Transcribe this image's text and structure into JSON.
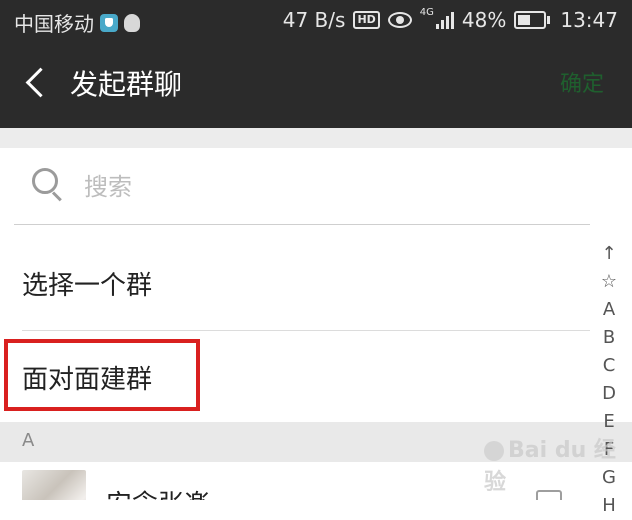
{
  "status_bar": {
    "carrier": "中国移动",
    "speed": "47 B/s",
    "hd": "HD",
    "network": "4G",
    "battery": "48%",
    "time": "13:47"
  },
  "title_bar": {
    "title": "发起群聊",
    "confirm_label": "确定"
  },
  "search": {
    "placeholder": "搜索",
    "value": ""
  },
  "options": {
    "select_group": "选择一个群",
    "face_to_face": "面对面建群"
  },
  "section": {
    "header": "A"
  },
  "contacts": [
    {
      "name": "安念张楽",
      "checked": false
    }
  ],
  "index_bar": [
    "↑",
    "☆",
    "A",
    "B",
    "C",
    "D",
    "E",
    "F",
    "G",
    "H"
  ],
  "watermark": {
    "text": "Bai du 经验"
  },
  "colors": {
    "bar_bg": "#2b2b2b",
    "confirm_disabled": "#1f5f2e",
    "highlight": "#d9201f",
    "section_bg": "#e9e9e9"
  }
}
